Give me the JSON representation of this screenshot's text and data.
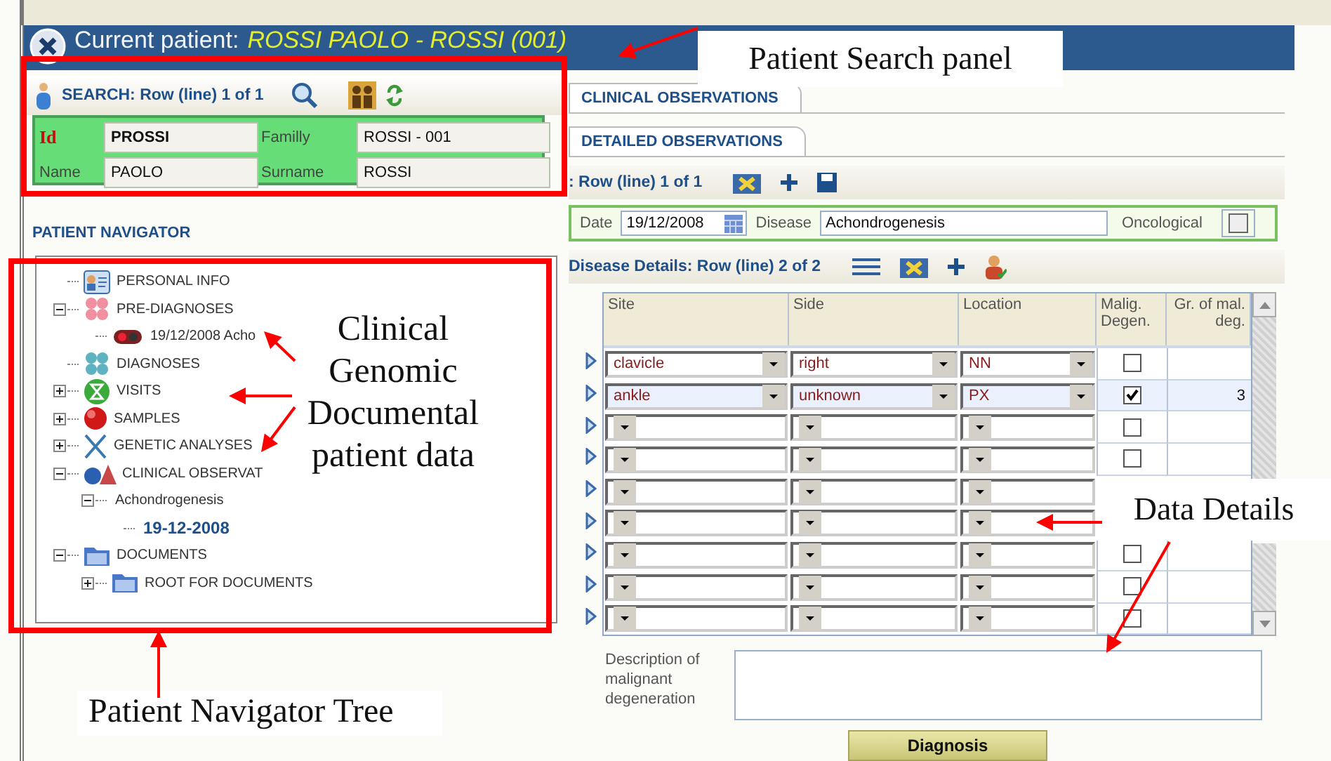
{
  "header": {
    "label": "Current patient:",
    "patient": "ROSSI PAOLO - ROSSI (001)"
  },
  "search": {
    "title": "SEARCH: Row (line) 1 of 1",
    "fields": [
      {
        "label": "Id",
        "value": "PROSSI",
        "kind": "key"
      },
      {
        "label": "Familly",
        "value": "ROSSI - 001",
        "kind": "plain"
      },
      {
        "label": "Name",
        "value": "PAOLO",
        "kind": "plain"
      },
      {
        "label": "Surname",
        "value": "ROSSI",
        "kind": "plain"
      }
    ]
  },
  "navigator": {
    "title": "PATIENT NAVIGATOR",
    "tree": [
      {
        "label": "PERSONAL INFO"
      },
      {
        "label": "PRE-DIAGNOSES",
        "expanded": true,
        "children": [
          {
            "label": "19/12/2008 Acho"
          }
        ]
      },
      {
        "label": "DIAGNOSES"
      },
      {
        "label": "VISITS",
        "expanded": false
      },
      {
        "label": "SAMPLES",
        "expanded": false
      },
      {
        "label": "GENETIC ANALYSES",
        "expanded": false
      },
      {
        "label": "CLINICAL OBSERVAT",
        "expanded": true,
        "children": [
          {
            "label": "Achondrogenesis",
            "expanded": true,
            "children": [
              {
                "label": "19-12-2008",
                "selected": true
              }
            ]
          }
        ]
      },
      {
        "label": "DOCUMENTS",
        "expanded": true,
        "children": [
          {
            "label": "ROOT FOR DOCUMENTS",
            "expanded": false
          }
        ]
      }
    ]
  },
  "tabs": [
    {
      "label": "CLINICAL OBSERVATIONS",
      "selected": true
    }
  ],
  "subtabs": [
    {
      "label": "DETAILED OBSERVATIONS",
      "selected": true
    }
  ],
  "record": {
    "title": ": Row (line) 1 of 1",
    "date_label": "Date",
    "date": "19/12/2008",
    "disease_label": "Disease",
    "disease": "Achondrogenesis",
    "oncological_label": "Oncological",
    "oncological": false
  },
  "details": {
    "title": "Disease Details: Row (line) 2 of 2",
    "columns": [
      "Site",
      "Side",
      "Location",
      "Malig. Degen.",
      "Gr. of mal. deg."
    ],
    "rows": [
      {
        "site": "clavicle",
        "side": "right",
        "location": "NN",
        "malignant": false,
        "selected": false
      },
      {
        "site": "ankle",
        "side": "unknown",
        "location": "PX",
        "malignant": true,
        "grade": "3",
        "selected": true
      },
      {
        "malignant": false,
        "selected": false
      },
      {
        "malignant": false,
        "selected": false
      },
      {
        "selected": false
      },
      {
        "selected": false
      },
      {
        "malignant": false,
        "selected": false
      },
      {
        "malignant": false,
        "selected": false
      },
      {
        "malignant": false,
        "selected": false
      }
    ]
  },
  "description": {
    "label": "Description of malignant degeneration"
  },
  "diagnosis_button": "Diagnosis",
  "annotations": [
    {
      "text": "Patient Search panel"
    },
    {
      "text": "Clinical Genomic Documental patient data"
    },
    {
      "text": "Data Details"
    },
    {
      "text": "Patient Navigator Tree"
    }
  ]
}
